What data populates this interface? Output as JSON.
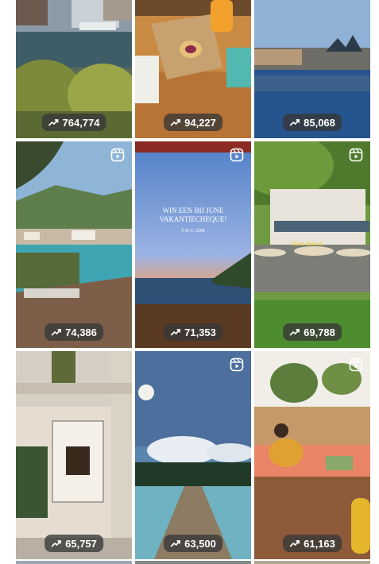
{
  "icons": {
    "trend": "trending-up-icon",
    "reel": "reels-icon"
  },
  "colors": {
    "badge_bg": "#373737",
    "page_bg": "#ffffff"
  },
  "posts": [
    {
      "views": "764,774",
      "reel": false,
      "scene": "canal-houses"
    },
    {
      "views": "94,227",
      "reel": false,
      "scene": "cafe-table"
    },
    {
      "views": "85,068",
      "reel": false,
      "scene": "castle-lake"
    },
    {
      "views": "74,386",
      "reel": true,
      "scene": "coastal-bay"
    },
    {
      "views": "71,353",
      "reel": true,
      "scene": "sunset-lake",
      "overlay": {
        "line1": "WIN EEN BIJ JUNE",
        "line2": "VAKANTIECHEQUE!",
        "line3": "T.W.V. 250€"
      }
    },
    {
      "views": "69,788",
      "reel": true,
      "scene": "terrace-restaurant",
      "sign": "Paris Best of"
    },
    {
      "views": "65,757",
      "reel": false,
      "scene": "poster-wall"
    },
    {
      "views": "63,500",
      "reel": true,
      "scene": "jetty-sky"
    },
    {
      "views": "61,163",
      "reel": true,
      "scene": "sofa-terrace"
    }
  ]
}
